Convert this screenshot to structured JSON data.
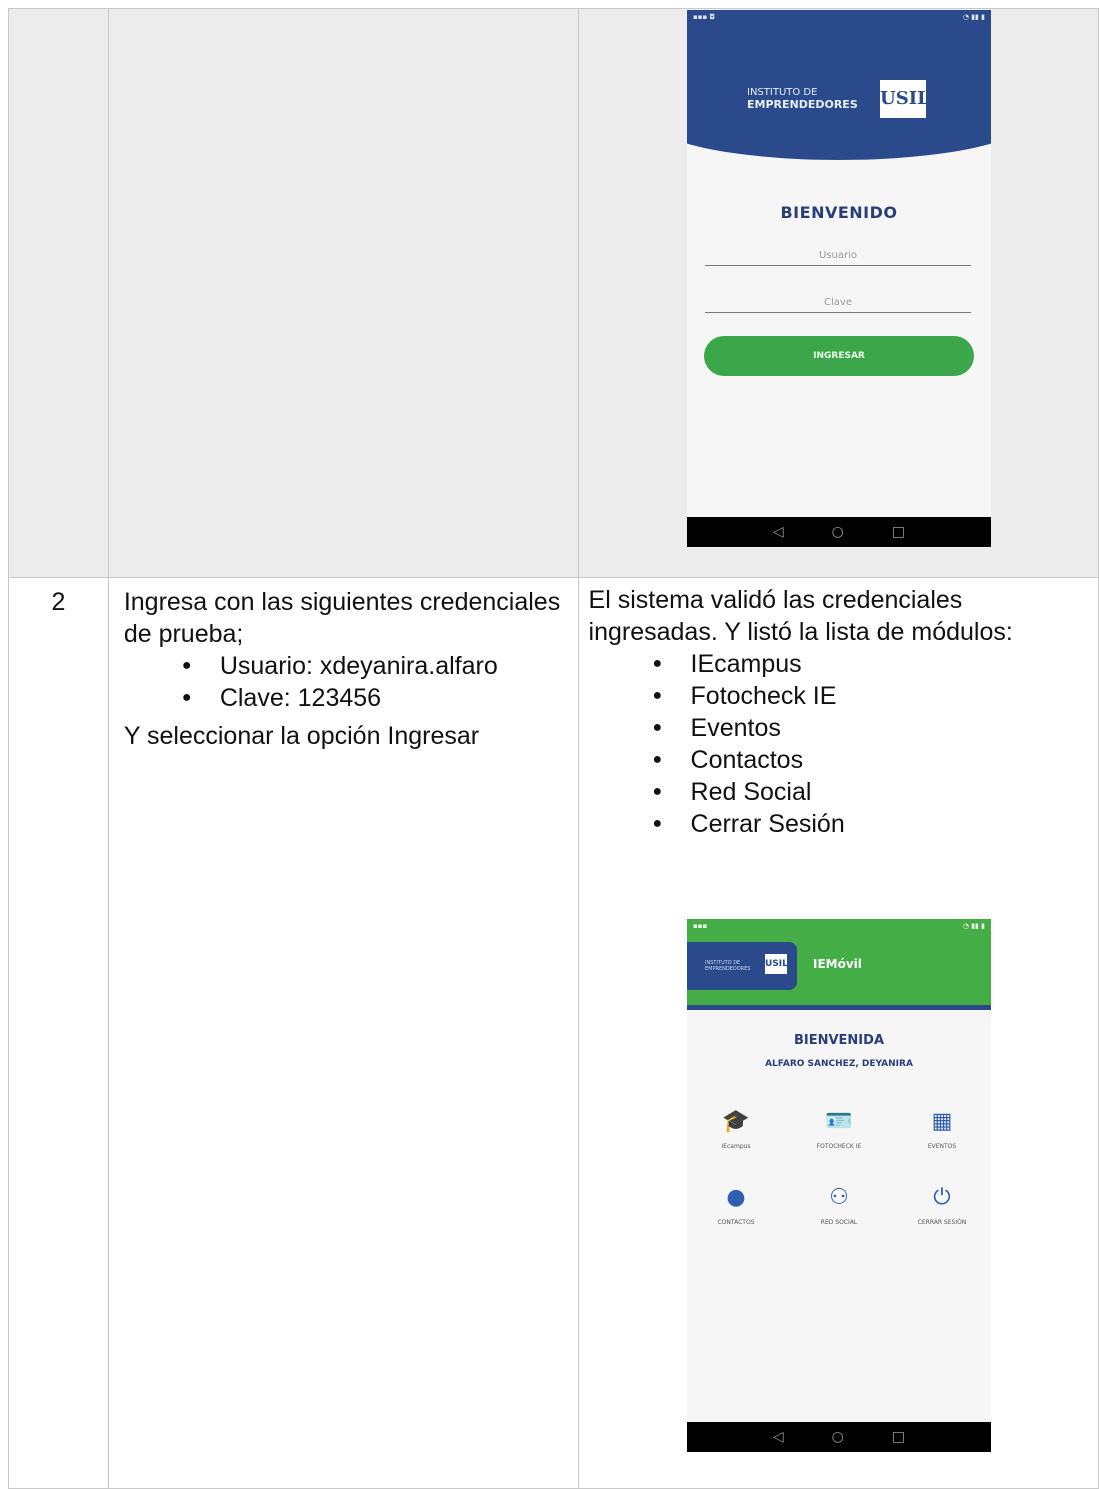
{
  "row2": {
    "number": "2",
    "action_intro": "Ingresa con las siguientes credenciales de prueba;",
    "credentials": [
      "Usuario: xdeyanira.alfaro",
      "Clave: 123456"
    ],
    "action_outro": "Y seleccionar la opción Ingresar",
    "result_intro": "El sistema validó las credenciales ingresadas.  Y listó la lista de módulos:",
    "modules_list": [
      "IEcampus",
      "Fotocheck IE",
      "Eventos",
      "Contactos",
      "Red Social",
      "Cerrar Sesión"
    ]
  },
  "login_screen": {
    "logo_line1": "INSTITUTO DE",
    "logo_line2": "EMPRENDEDORES",
    "logo_mark": "USIL",
    "welcome": "BIENVENIDO",
    "user_placeholder": "Usuario",
    "pass_placeholder": "Clave",
    "button": "INGRESAR",
    "header_color": "#2a4a8c",
    "button_color": "#3ba64a"
  },
  "home_screen": {
    "app_name": "IEMóvil",
    "welcome": "BIENVENIDA",
    "user_name": "ALFARO SANCHEZ, DEYANIRA",
    "modules": [
      {
        "label": "IEcampus",
        "icon": "graduation-cap-icon"
      },
      {
        "label": "FOTOCHECK IE",
        "icon": "id-card-icon"
      },
      {
        "label": "EVENTOS",
        "icon": "calendar-icon"
      },
      {
        "label": "CONTACTOS",
        "icon": "contacts-icon"
      },
      {
        "label": "RED SOCIAL",
        "icon": "people-icon"
      },
      {
        "label": "CERRAR SESIÓN",
        "icon": "power-icon"
      }
    ],
    "topbar_color": "#45ad46"
  }
}
